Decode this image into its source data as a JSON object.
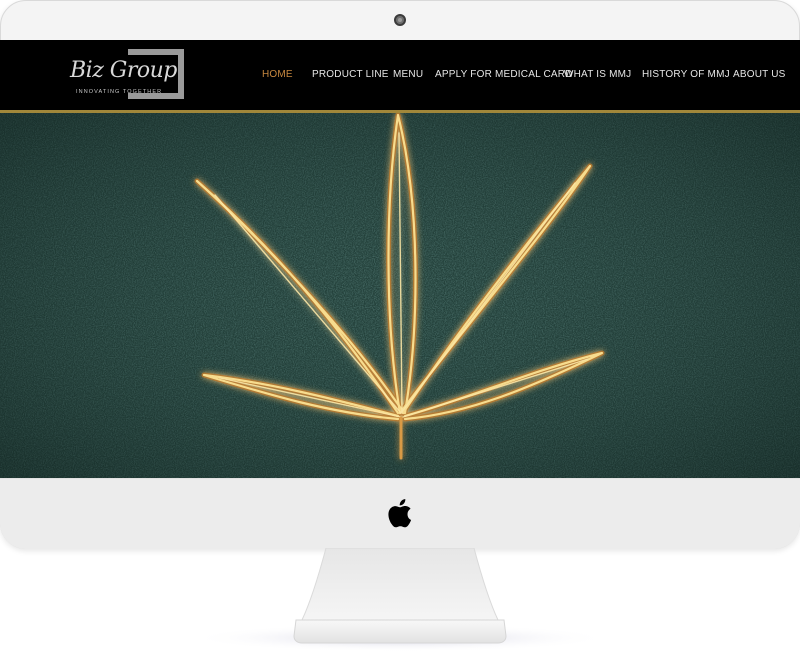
{
  "device": {
    "camera_icon": "camera-icon",
    "brand_icon": "apple-logo-icon"
  },
  "site": {
    "logo": {
      "name": "Biz Group",
      "tagline": "INNOVATING TOGETHER"
    },
    "nav": {
      "items": [
        {
          "label": "HOME",
          "active": true
        },
        {
          "label": "PRODUCT LINE",
          "active": false
        },
        {
          "label": "MENU",
          "active": false
        },
        {
          "label": "APPLY FOR MEDICAL CARD",
          "active": false
        },
        {
          "label": "WHAT IS MMJ",
          "active": false
        },
        {
          "label": "HISTORY OF MMJ",
          "active": false
        },
        {
          "label": "ABOUT US",
          "active": false
        }
      ]
    },
    "hero": {
      "image": "glowing-cannabis-leaf-on-green-textured-background"
    },
    "colors": {
      "header_bg": "#000000",
      "accent_gold": "#a1873a",
      "active_nav": "#c8883f",
      "hero_bg": "#213a36",
      "leaf_glow": "#f3d27a"
    }
  }
}
